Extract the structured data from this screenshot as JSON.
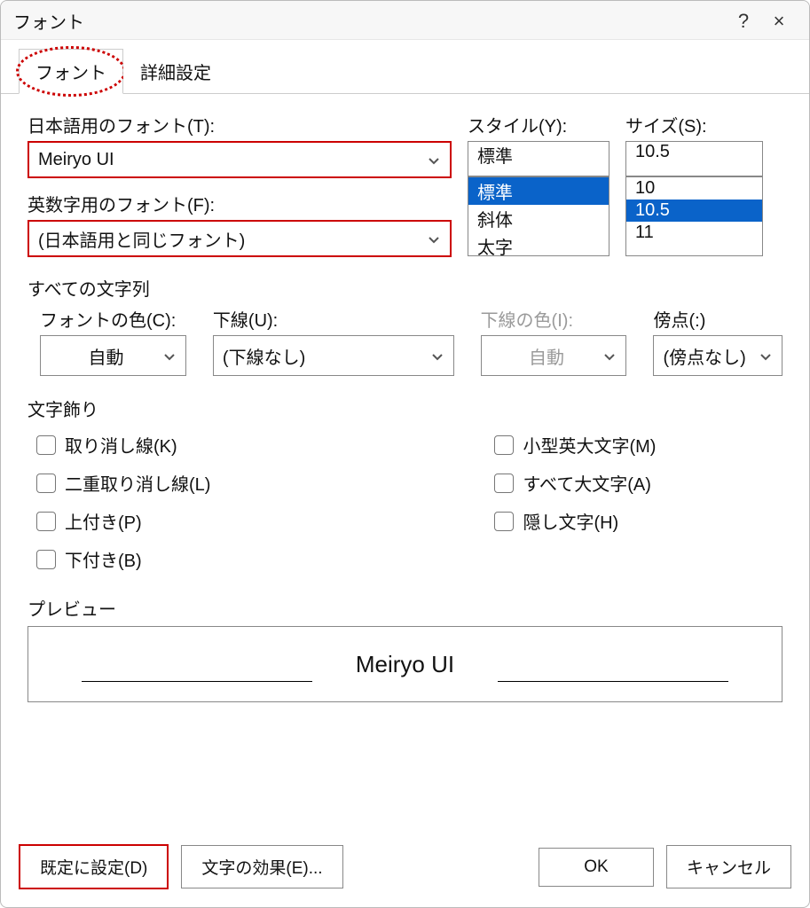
{
  "window": {
    "title": "フォント",
    "help": "?",
    "close": "×"
  },
  "tabs": {
    "font": "フォント",
    "advanced": "詳細設定"
  },
  "labels": {
    "jp_font": "日本語用のフォント(T):",
    "latin_font": "英数字用のフォント(F):",
    "style": "スタイル(Y):",
    "size": "サイズ(S):",
    "all_text": "すべての文字列",
    "font_color": "フォントの色(C):",
    "underline": "下線(U):",
    "underline_color": "下線の色(I):",
    "emphasis": "傍点(:)",
    "effects": "文字飾り",
    "preview": "プレビュー"
  },
  "values": {
    "jp_font": "Meiryo UI",
    "latin_font": "(日本語用と同じフォント)",
    "style_input": "標準",
    "size_input": "10.5",
    "font_color": "自動",
    "underline": "(下線なし)",
    "underline_color": "自動",
    "emphasis": "(傍点なし)",
    "preview_text": "Meiryo UI"
  },
  "style_options": [
    "標準",
    "斜体",
    "太字"
  ],
  "size_options": [
    "10",
    "10.5",
    "11"
  ],
  "size_selected": "10.5",
  "style_selected": "標準",
  "checks": {
    "strikethrough": "取り消し線(K)",
    "double_strike": "二重取り消し線(L)",
    "superscript": "上付き(P)",
    "subscript": "下付き(B)",
    "small_caps": "小型英大文字(M)",
    "all_caps": "すべて大文字(A)",
    "hidden": "隠し文字(H)"
  },
  "buttons": {
    "set_default": "既定に設定(D)",
    "text_effects": "文字の効果(E)...",
    "ok": "OK",
    "cancel": "キャンセル"
  }
}
